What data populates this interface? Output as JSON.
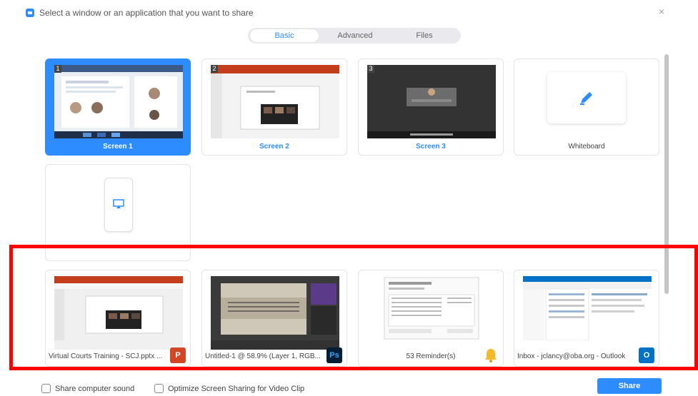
{
  "window": {
    "title": "Select a window or an application that you want to share",
    "close_glyph": "×"
  },
  "tabs": [
    {
      "label": "Basic",
      "active": true
    },
    {
      "label": "Advanced",
      "active": false
    },
    {
      "label": "Files",
      "active": false
    }
  ],
  "screens": [
    {
      "number": "1",
      "label": "Screen 1",
      "selected": true
    },
    {
      "number": "2",
      "label": "Screen 2",
      "selected": false
    },
    {
      "number": "3",
      "label": "Screen 3",
      "selected": false
    }
  ],
  "whiteboard": {
    "label": "Whiteboard",
    "icon": "pencil-icon"
  },
  "iphone_ipad": {
    "icon": "airplay-icon"
  },
  "apps": [
    {
      "label": "Virtual Courts Training - SCJ.pptx ...",
      "badge": "P",
      "badge_color": "#d24726",
      "icon": "powerpoint-icon"
    },
    {
      "label": "Untitled-1 @ 58.9% (Layer 1, RGB...",
      "badge": "Ps",
      "badge_color": "#001e36",
      "icon": "photoshop-icon"
    },
    {
      "label": "53 Reminder(s)",
      "badge": "",
      "badge_color": "#f5b828",
      "icon": "bell-icon"
    },
    {
      "label": "Inbox - jclancy@oba.org - Outlook",
      "badge": "O",
      "badge_color": "#0072c6",
      "icon": "outlook-icon"
    }
  ],
  "footer": {
    "share_sound_label": "Share computer sound",
    "optimize_label": "Optimize Screen Sharing for Video Clip",
    "share_button_label": "Share"
  },
  "colors": {
    "accent": "#2D8CFF",
    "highlight": "#ff0000"
  }
}
